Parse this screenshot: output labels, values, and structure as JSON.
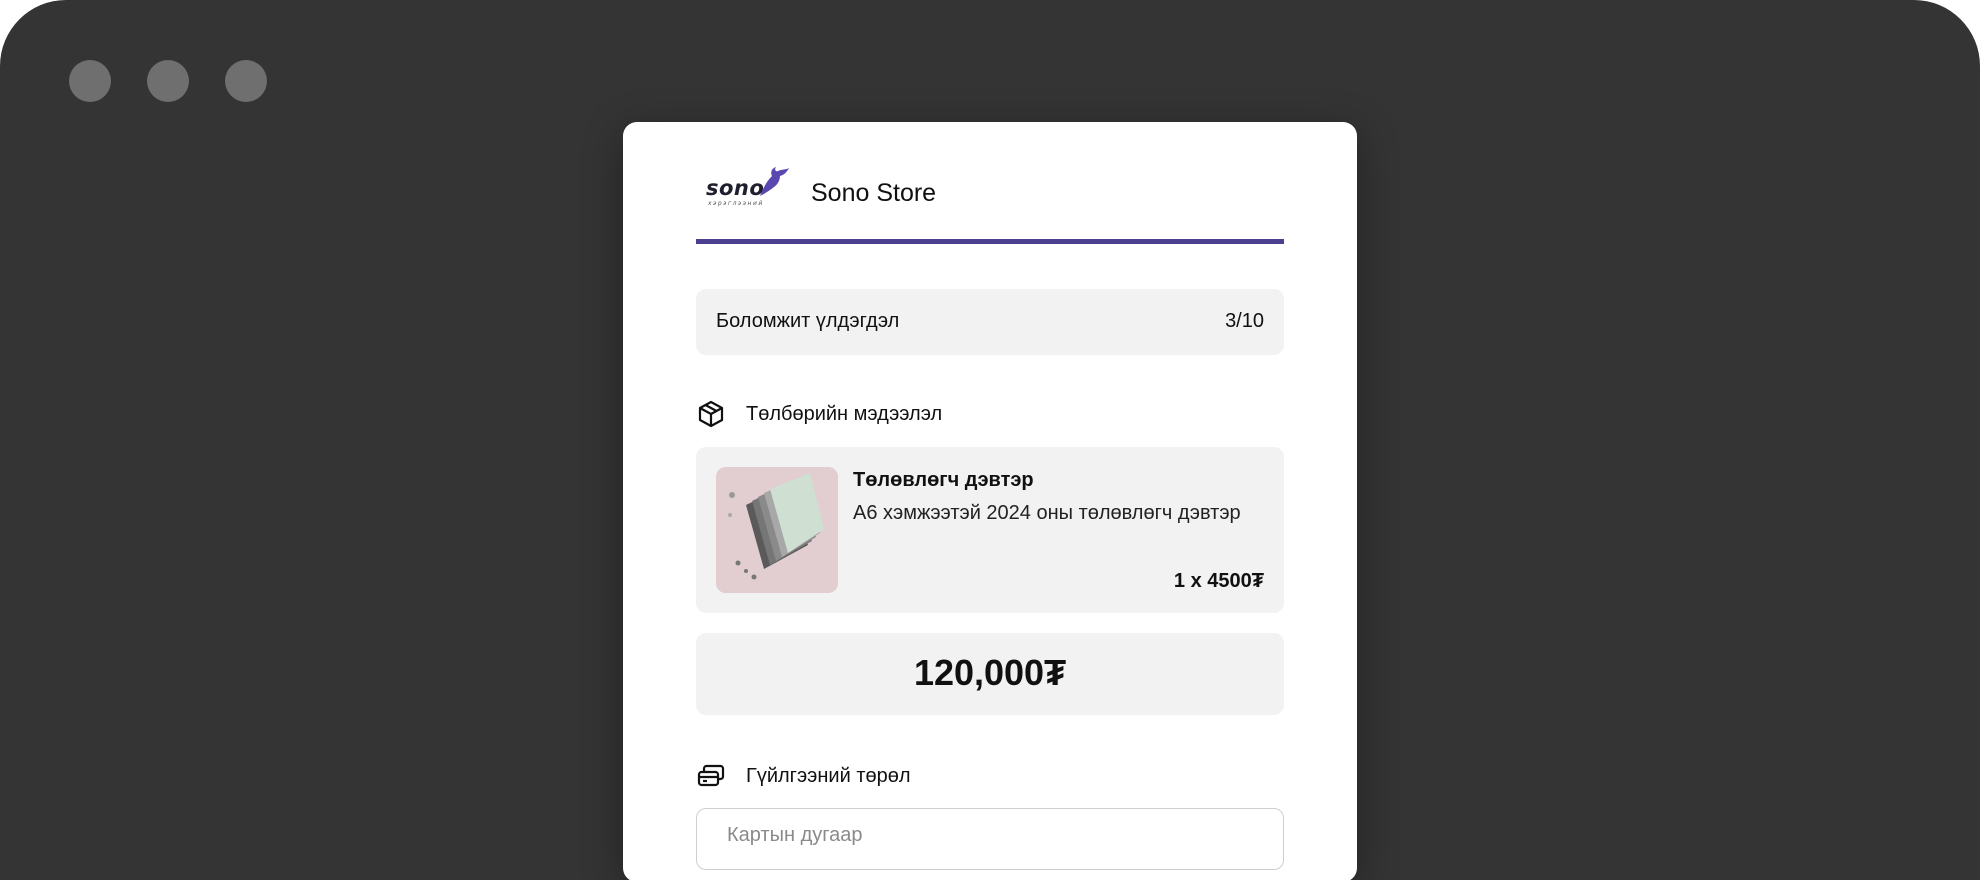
{
  "window": {
    "controls": [
      "window-dot",
      "window-dot",
      "window-dot"
    ]
  },
  "store": {
    "logo_text": "sono",
    "logo_subtext": "хэрэглээний",
    "name": "Sono Store",
    "accent_color": "#4b3f8f"
  },
  "balance": {
    "label": "Боломжит үлдэгдэл",
    "value": "3/10"
  },
  "payment_info": {
    "title": "Төлбөрийн мэдээлэл",
    "icon": "box-icon"
  },
  "product": {
    "name": "Төлөвлөгч дэвтэр",
    "description": "А6 хэмжээтэй 2024 оны төлөвлөгч дэвтэр",
    "quantity_price": "1 x 4500₮"
  },
  "total": {
    "amount": "120,000₮"
  },
  "transaction_type": {
    "title": "Гүйлгээний төрөл",
    "icon": "cards-icon"
  },
  "card_number": {
    "placeholder": "Картын дугаар",
    "value": ""
  }
}
